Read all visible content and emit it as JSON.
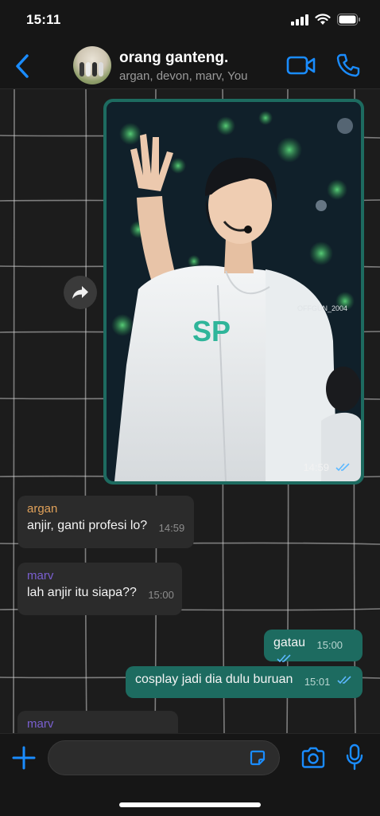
{
  "status_bar": {
    "time": "15:11"
  },
  "header": {
    "group_name": "orang ganteng.",
    "members": "argan, devon, marv, You"
  },
  "image_message": {
    "time": "14:59",
    "watermark": "OFFGUN_2004",
    "shirt_text": "SP"
  },
  "messages": [
    {
      "sender": "argan",
      "sender_color": "#e0a15a",
      "text": "anjir, ganti profesi lo?",
      "time": "14:59",
      "direction": "in"
    },
    {
      "sender": "marv",
      "sender_color": "#7a5fd0",
      "text": "lah anjir itu siapa??",
      "time": "15:00",
      "direction": "in"
    },
    {
      "text": "gatau",
      "time": "15:00",
      "direction": "out"
    },
    {
      "text": "cosplay jadi dia dulu buruan",
      "time": "15:01",
      "direction": "out"
    },
    {
      "sender": "marv",
      "sender_color": "#7a5fd0",
      "text": "",
      "direction": "in"
    }
  ],
  "input": {
    "placeholder": ""
  },
  "colors": {
    "accent": "#1a8cff",
    "outgoing_bubble": "#1d6b60",
    "incoming_bubble": "#2b2b2b",
    "read_ticks": "#5cb8ff"
  }
}
